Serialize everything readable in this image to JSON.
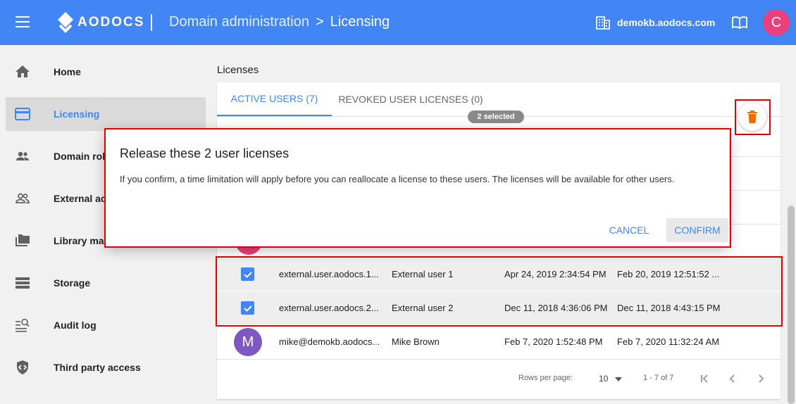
{
  "header": {
    "brand": "AODOCS",
    "breadcrumb_root": "Domain administration",
    "breadcrumb_sep": ">",
    "breadcrumb_current": "Licensing",
    "domain": "demokb.aodocs.com",
    "avatar_letter": "C"
  },
  "sidebar": {
    "items": [
      {
        "label": "Home",
        "icon": "home-icon"
      },
      {
        "label": "Licensing",
        "icon": "card-icon"
      },
      {
        "label": "Domain role",
        "icon": "people-icon"
      },
      {
        "label": "External ac",
        "icon": "external-people-icon"
      },
      {
        "label": "Library mar",
        "icon": "folders-icon"
      },
      {
        "label": "Storage",
        "icon": "storage-icon"
      },
      {
        "label": "Audit log",
        "icon": "audit-log-icon"
      },
      {
        "label": "Third party access",
        "icon": "code-shield-icon"
      }
    ]
  },
  "main": {
    "section_title": "Licenses",
    "tabs": [
      {
        "label": "ACTIVE USERS (7)",
        "active": true
      },
      {
        "label": "REVOKED USER LICENSES (0)",
        "active": false
      }
    ],
    "selected_badge": "2 selected",
    "rows": [
      {
        "email": "external.user.aodocs.1...",
        "name": "External user 1",
        "created": "Apr 24, 2019 2:34:54 PM",
        "last": "Feb 20, 2019 12:51:52 ...",
        "selected": true
      },
      {
        "email": "external.user.aodocs.2...",
        "name": "External user 2",
        "created": "Dec 11, 2018 4:36:06 PM",
        "last": "Dec 11, 2018 4:43:15 PM",
        "selected": true
      },
      {
        "email": "mike@demokb.aodocs...",
        "name": "Mike Brown",
        "created": "Feb 7, 2020 1:52:48 PM",
        "last": "Feb 7, 2020 11:32:24 AM",
        "selected": false,
        "avatar": "M"
      }
    ],
    "footer": {
      "rows_per_page_label": "Rows per page:",
      "rows_per_page_value": "10",
      "range": "1 - 7 of 7"
    }
  },
  "dialog": {
    "title": "Release these 2 user licenses",
    "body": "If you confirm, a time limitation will apply before you can reallocate a license to these users. The licenses will be available for other users.",
    "cancel_label": "CANCEL",
    "confirm_label": "CONFIRM"
  },
  "colors": {
    "primary": "#4285f4",
    "accent_pink": "#ec407a",
    "delete_orange": "#ef6c00",
    "highlight_red": "#e00000"
  }
}
